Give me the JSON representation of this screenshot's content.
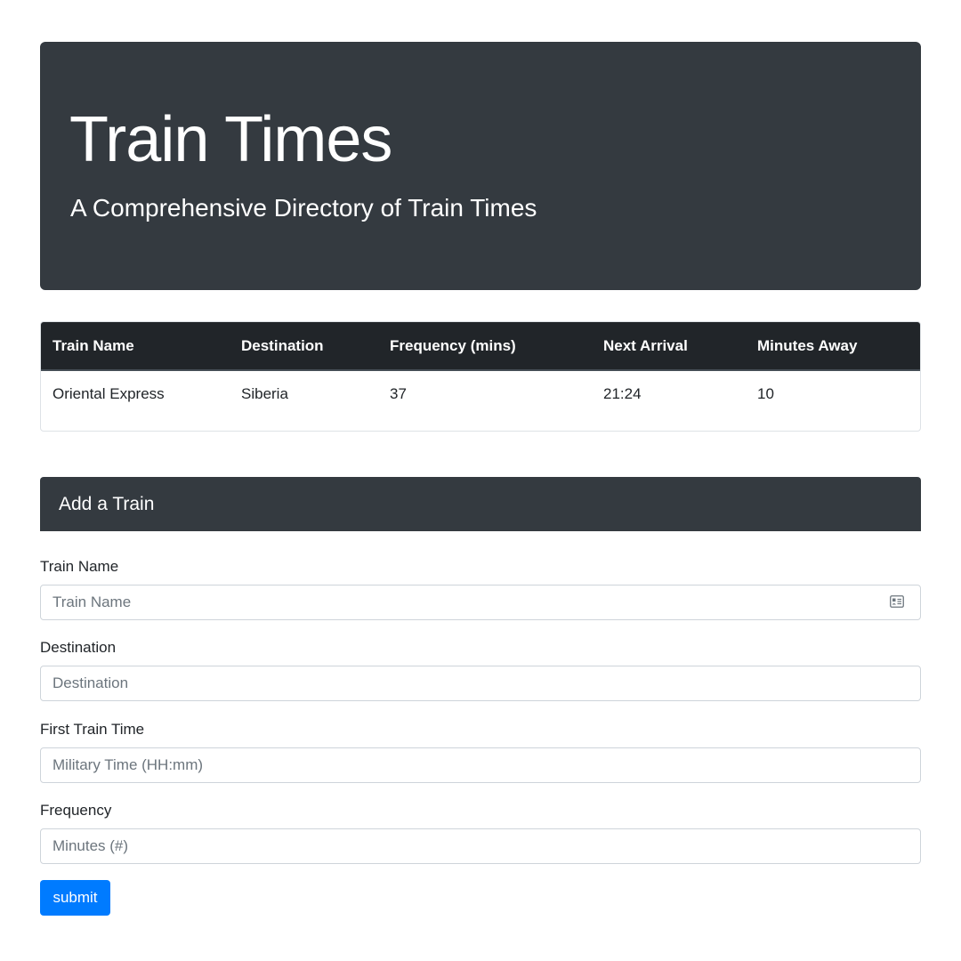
{
  "jumbotron": {
    "title": "Train Times",
    "subtitle": "A Comprehensive Directory of Train Times"
  },
  "table": {
    "headers": [
      "Train Name",
      "Destination",
      "Frequency (mins)",
      "Next Arrival",
      "Minutes Away"
    ],
    "rows": [
      [
        "Oriental Express",
        "Siberia",
        "37",
        "21:24",
        "10"
      ]
    ]
  },
  "form": {
    "heading": "Add a Train",
    "fields": [
      {
        "label": "Train Name",
        "placeholder": "Train Name",
        "icon": "contact-card-icon"
      },
      {
        "label": "Destination",
        "placeholder": "Destination"
      },
      {
        "label": "First Train Time",
        "placeholder": "Military Time (HH:mm)"
      },
      {
        "label": "Frequency",
        "placeholder": "Minutes (#)"
      }
    ],
    "submit_label": "submit"
  },
  "colors": {
    "header_bg": "#343a40",
    "table_header_bg": "#212529",
    "button_primary": "#007bff"
  }
}
